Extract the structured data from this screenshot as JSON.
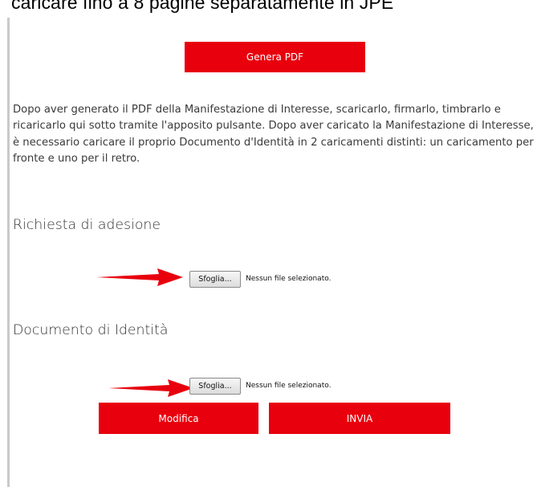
{
  "banner_text": "caricare fino a 8 pagine separatamente in JPE",
  "generate_button_label": "Genera PDF",
  "instructions_text": "Dopo aver generato il PDF della Manifestazione di Interesse, scaricarlo, firmarlo, timbrarlo e ricaricarlo qui sotto tramite l'apposito pulsante. Dopo aver caricato la Manifestazione di Interesse, è necessario caricare il proprio Documento d'Identità in 2 caricamenti distinti: un caricamento per fronte e uno per il retro.",
  "sections": [
    {
      "title": "Richiesta di adesione",
      "browse_label": "Sfoglia...",
      "no_file_text": "Nessun file selezionato."
    },
    {
      "title": "Documento di Identità",
      "browse_label": "Sfoglia...",
      "no_file_text": "Nessun file selezionato."
    }
  ],
  "modify_button_label": "Modifica",
  "send_button_label": "INVIA",
  "colors": {
    "accent_red": "#e8000d",
    "arrow_red": "#e8000d",
    "left_rule": "#c9c9c9"
  },
  "icons": {
    "annotation_arrow": "arrow-right-icon"
  }
}
